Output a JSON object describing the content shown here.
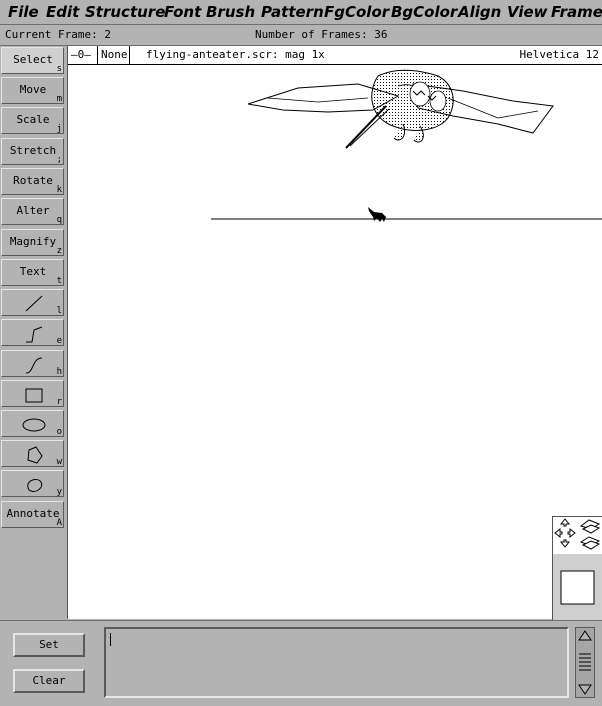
{
  "menubar": {
    "items": [
      "File",
      "Edit",
      "Structure",
      "Font",
      "Brush",
      "Pattern",
      "FgColor",
      "BgColor",
      "Align",
      "View",
      "Frame"
    ]
  },
  "status": {
    "current_frame_label": "Current Frame: 2",
    "number_of_frames_label": "Number of Frames: 36"
  },
  "tools": [
    {
      "label": "Select",
      "key": "s",
      "selected": true
    },
    {
      "label": "Move",
      "key": "m"
    },
    {
      "label": "Scale",
      "key": "j"
    },
    {
      "label": "Stretch",
      "key": ";"
    },
    {
      "label": "Rotate",
      "key": "k"
    },
    {
      "label": "Alter",
      "key": "q"
    },
    {
      "label": "Magnify",
      "key": "z"
    },
    {
      "label": "Text",
      "key": "t"
    },
    {
      "icon": "line-icon",
      "key": "l"
    },
    {
      "icon": "multiline-icon",
      "key": "e"
    },
    {
      "icon": "spline-icon",
      "key": "h"
    },
    {
      "icon": "rectangle-icon",
      "key": "r"
    },
    {
      "icon": "ellipse-icon",
      "key": "o"
    },
    {
      "icon": "polygon-icon",
      "key": "w"
    },
    {
      "icon": "closed-spline-icon",
      "key": "y"
    },
    {
      "label": "Annotate",
      "key": "A"
    }
  ],
  "canvas_header": {
    "brush": "None",
    "file_info": "flying-anteater.scr:  mag 1x",
    "font": "Helvetica 12"
  },
  "bottom": {
    "set_label": "Set",
    "clear_label": "Clear",
    "command_value": ""
  }
}
